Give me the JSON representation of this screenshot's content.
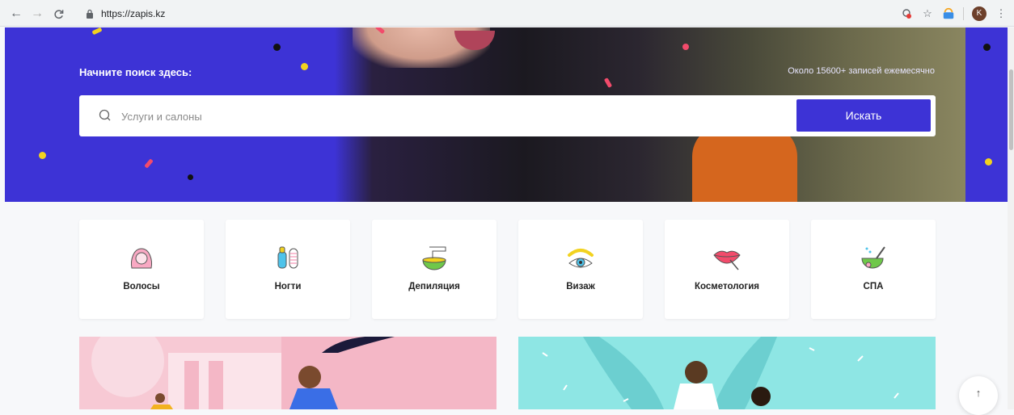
{
  "browser": {
    "url": "https://zapis.kz",
    "avatar_initial": "K"
  },
  "hero": {
    "title": "Начните поиск здесь:",
    "stat": "Около 15600+ записей ежемесячно",
    "search_placeholder": "Услуги и салоны",
    "search_button": "Искать"
  },
  "categories": [
    {
      "label": "Волосы",
      "icon": "hair-icon"
    },
    {
      "label": "Ногти",
      "icon": "nails-icon"
    },
    {
      "label": "Депиляция",
      "icon": "depilation-icon"
    },
    {
      "label": "Визаж",
      "icon": "makeup-icon"
    },
    {
      "label": "Косметология",
      "icon": "cosmetology-icon"
    },
    {
      "label": "СПА",
      "icon": "spa-icon"
    }
  ],
  "colors": {
    "brand": "#3d33d6",
    "confetti_yellow": "#f2d21f",
    "confetti_pink": "#f24b6b"
  }
}
